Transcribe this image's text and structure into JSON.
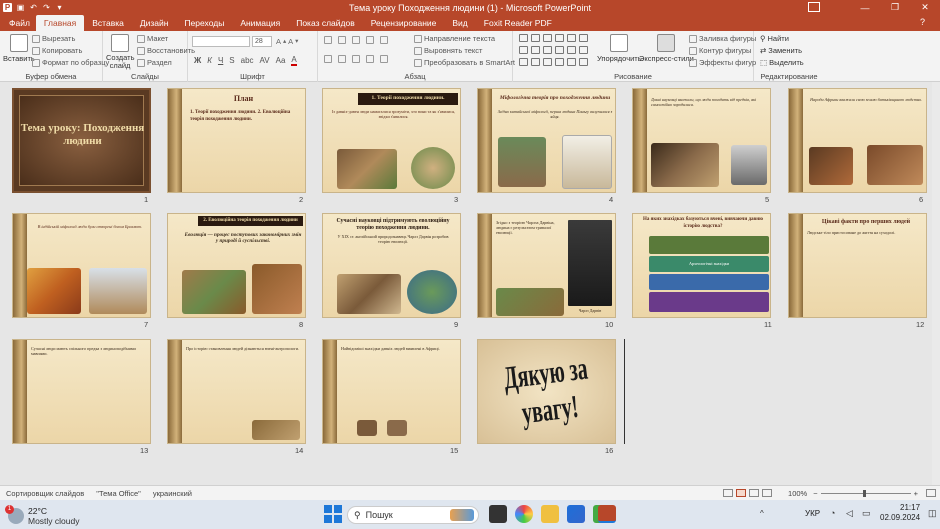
{
  "window": {
    "title": "Тема уроку Походження людини (1) - Microsoft PowerPoint",
    "app_badge": "P"
  },
  "ribbon_tabs": [
    "Файл",
    "Главная",
    "Вставка",
    "Дизайн",
    "Переходы",
    "Анимация",
    "Показ слайдов",
    "Рецензирование",
    "Вид",
    "Foxit Reader PDF"
  ],
  "active_tab": "Главная",
  "ribbon": {
    "clipboard": {
      "label": "Буфер обмена",
      "paste": "Вставить",
      "cut": "Вырезать",
      "copy": "Копировать",
      "format_painter": "Формат по образцу"
    },
    "slides": {
      "label": "Слайды",
      "new_slide": "Создать слайд",
      "layout": "Макет",
      "reset": "Восстановить",
      "section": "Раздел"
    },
    "font": {
      "label": "Шрифт",
      "size": "28"
    },
    "paragraph": {
      "label": "Абзац",
      "text_direction": "Направление текста",
      "align_text": "Выровнять текст",
      "smartart": "Преобразовать в SmartArt"
    },
    "drawing": {
      "label": "Рисование",
      "arrange": "Упорядочить",
      "quick_styles": "Экспресс-стили",
      "shape_fill": "Заливка фигуры",
      "shape_outline": "Контур фигуры",
      "shape_effects": "Эффекты фигур"
    },
    "editing": {
      "label": "Редактирование",
      "find": "Найти",
      "replace": "Заменить",
      "select": "Выделить"
    }
  },
  "slides": [
    {
      "n": "1",
      "title": "Тема уроку: Походження людини"
    },
    {
      "n": "2",
      "title": "План",
      "text": "1. Теорії походження людини. 2. Еволюційна теорія походження людини."
    },
    {
      "n": "3",
      "title": "1. Теорії походження людини.",
      "text": "Із давніх-давен люди намагалися зрозуміти, хто вони та як з'явилися, звідки з'явилися."
    },
    {
      "n": "4",
      "title": "Міфологічна теорія про походження людини",
      "text": "Згідно китайської міфології, перша людина Паньгу вилупилася з яйця."
    },
    {
      "n": "5",
      "text": "Давні науковці вважали, що люди походять від предків, які самостійно зародилися."
    },
    {
      "n": "6",
      "text": "Народи Африки вважали свою землю батьківщиною людства."
    },
    {
      "n": "7",
      "text": "В індійській міфології люди були створені богом Брахмою."
    },
    {
      "n": "8",
      "title": "2. Еволюційна теорія походження людини",
      "text": "Еволюція — процес поступових закономірних змін у природі й суспільстві."
    },
    {
      "n": "9",
      "title": "Сучасні науковці підтримують еволюційну теорію походження людини.",
      "text": "У XIX ст. англійський природознавець Чарлз Дарвін розробив теорію еволюції."
    },
    {
      "n": "10",
      "text": "Згідно з теорією Чарлза Дарвіна, людина є результатом тривалої еволюції.",
      "caption": "Чарлз Дарвін"
    },
    {
      "n": "11",
      "title": "На яких знахідках базуються вчені, вивчаючи давню історію людства?",
      "text": "Археологічні знахідки"
    },
    {
      "n": "12",
      "title": "Цікаві факти про перших людей",
      "text": "Людське тіло пристосоване до життя на суходолі."
    },
    {
      "n": "13",
      "text": "Сучасні люди мають спільного предка з людиноподібними мавпами."
    },
    {
      "n": "14",
      "text": "Про історію становлення людей дізнаються вчені-антропологи."
    },
    {
      "n": "15",
      "text": "Найвідоміші знахідки давніх людей виявлені в Африці."
    },
    {
      "n": "16",
      "title": "Дякую за увагу!"
    }
  ],
  "status": {
    "view": "Сортировщик слайдов",
    "theme": "\"Тема Office\"",
    "language": "украинский",
    "zoom": "100%"
  },
  "taskbar": {
    "weather_temp": "22°C",
    "weather_desc": "Mostly cloudy",
    "search": "Пошук",
    "lang": "УКР",
    "time": "21:17",
    "date": "02.09.2024",
    "badge": "1"
  }
}
